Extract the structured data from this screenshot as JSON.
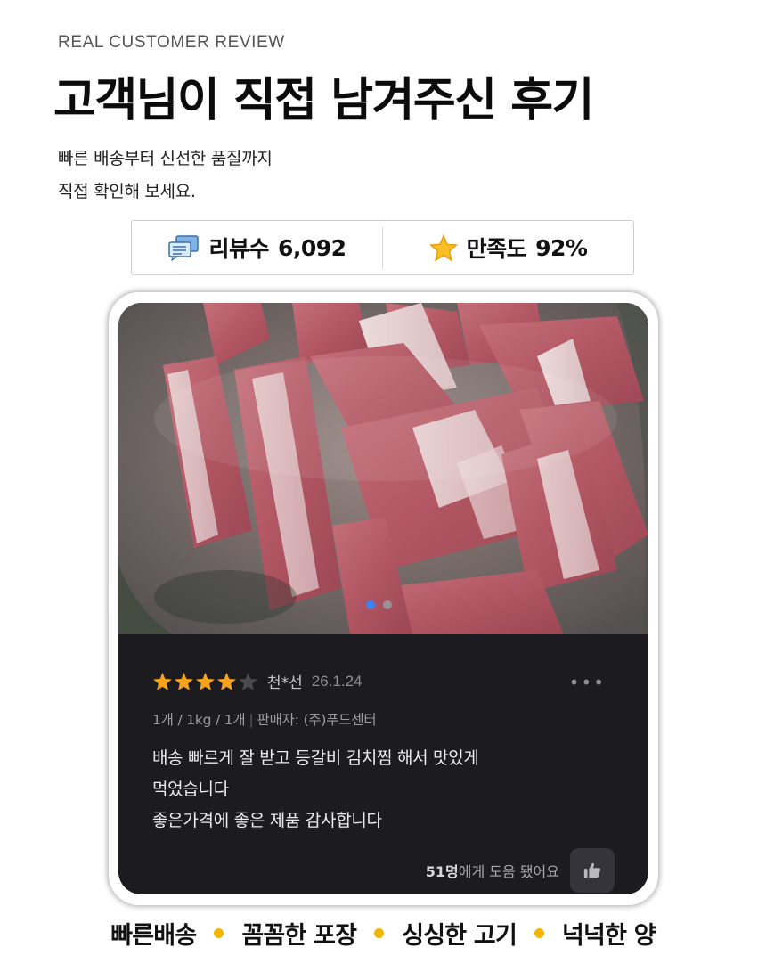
{
  "header": {
    "eyebrow": "REAL CUSTOMER REVIEW",
    "title": "고객님이 직접 남겨주신 후기",
    "desc_line1": "빠른 배송부터 신선한 품질까지",
    "desc_line2": "직접 확인해 보세요."
  },
  "stats": {
    "reviews_label": "리뷰수",
    "reviews_value": "6,092",
    "reviews_icon": "chat-bubbles-icon",
    "satisfaction_label": "만족도",
    "satisfaction_value": "92%",
    "satisfaction_icon": "star-icon"
  },
  "review": {
    "photo_icon": "raw-pork-ribs-photo",
    "carousel_dots": 2,
    "carousel_active": 0,
    "rating": 4,
    "rating_max": 5,
    "author": "천*선",
    "date": "26.1.24",
    "option": "1개 / 1kg / 1개",
    "seller": "판매자: (주)푸드센터",
    "text_line1": "배송 빠르게 잘 받고 등갈비 김치찜 해서 맛있게",
    "text_line2": "먹었습니다",
    "text_line3": "좋은가격에 좋은 제품 감사합니다",
    "more_label": "•••",
    "helpful_count": "51명",
    "helpful_suffix": "에게 도움 됐어요",
    "helpful_icon": "thumbs-up-icon"
  },
  "tags": [
    "빠른배송",
    "꼼꼼한 포장",
    "싱싱한 고기",
    "넉넉한 양"
  ],
  "colors": {
    "star_filled": "#f7a21b",
    "star_empty": "#4a4a4e",
    "tag_dot": "#f2b705",
    "dark_bg": "#1c1c20"
  }
}
